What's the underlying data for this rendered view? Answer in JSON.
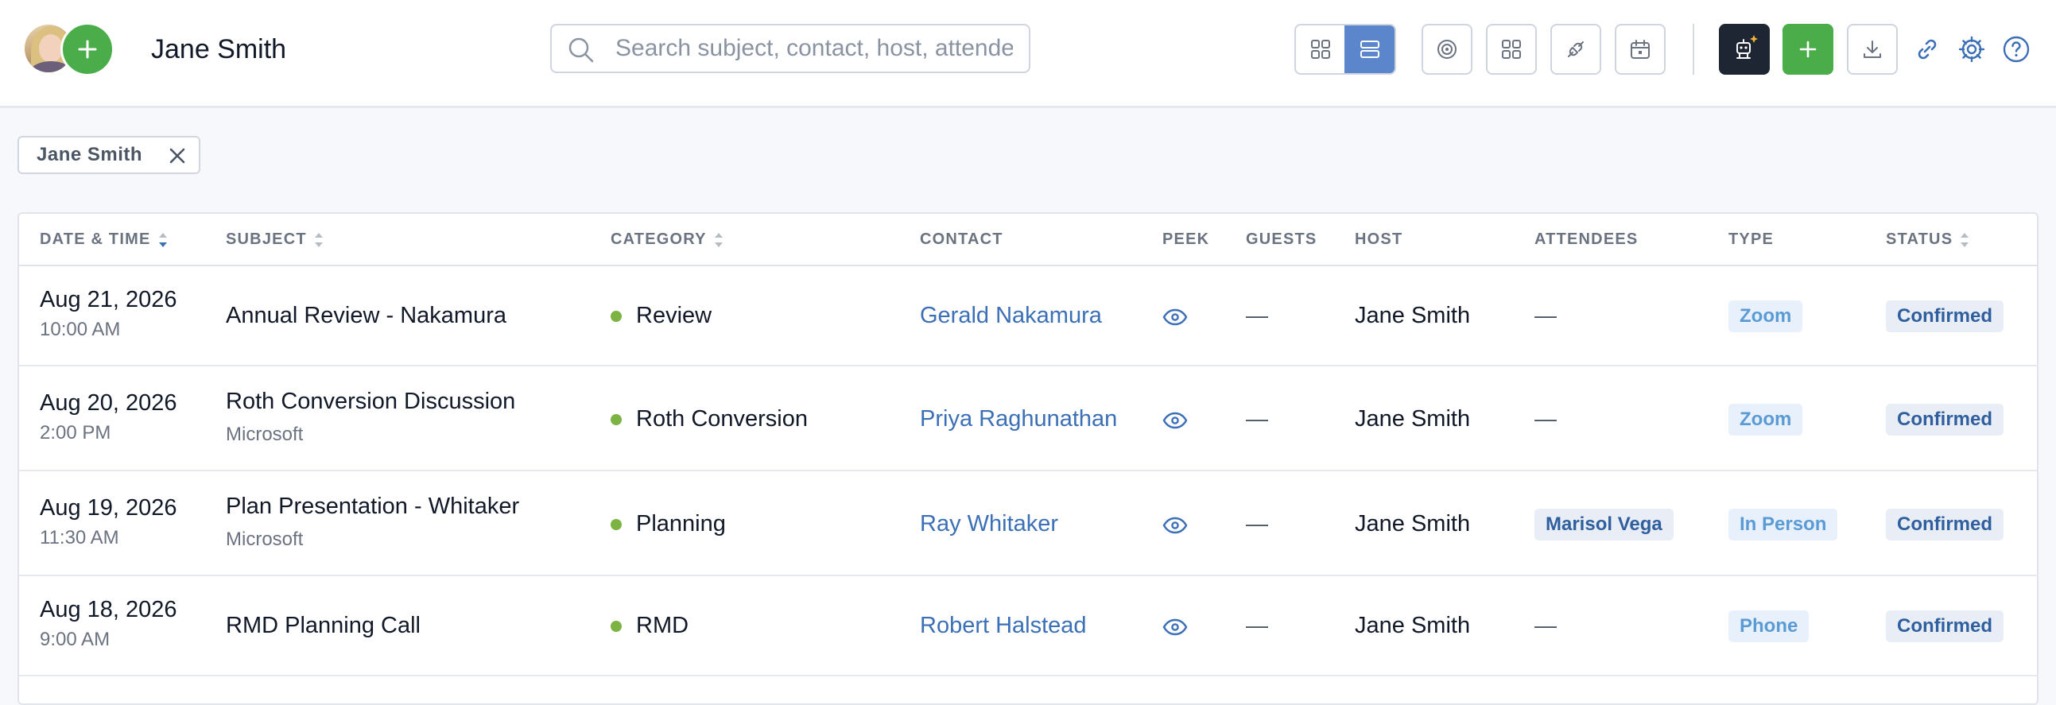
{
  "header": {
    "user_name": "Jane Smith",
    "search_placeholder": "Search subject, contact, host, attendees..."
  },
  "toolbar": {
    "icons": [
      "grid-view-icon",
      "list-view-icon",
      "target-icon",
      "apps-icon",
      "integration-icon",
      "calendar-icon",
      "ai-assistant-icon",
      "add-icon",
      "download-icon",
      "link-icon",
      "settings-icon",
      "help-icon"
    ],
    "accent": "#5b86cc",
    "green": "#4aad4a"
  },
  "filters": [
    {
      "label": "Jane Smith"
    }
  ],
  "table": {
    "columns": [
      "DATE & TIME",
      "SUBJECT",
      "CATEGORY",
      "CONTACT",
      "PEEK",
      "GUESTS",
      "HOST",
      "ATTENDEES",
      "TYPE",
      "STATUS"
    ],
    "rows": [
      {
        "date": "Aug 21, 2026",
        "time": "10:00 AM",
        "subject": "Annual Review - Nakamura",
        "subtitle": "",
        "category": "Review",
        "contact": "Gerald Nakamura",
        "guests": "—",
        "host": "Jane Smith",
        "attendees": "—",
        "type": "Zoom",
        "status": "Confirmed"
      },
      {
        "date": "Aug 20, 2026",
        "time": "2:00 PM",
        "subject": "Roth Conversion Discussion",
        "subtitle": "Microsoft",
        "category": "Roth Conversion",
        "contact": "Priya Raghunathan",
        "guests": "—",
        "host": "Jane Smith",
        "attendees": "—",
        "type": "Zoom",
        "status": "Confirmed"
      },
      {
        "date": "Aug 19, 2026",
        "time": "11:30 AM",
        "subject": "Plan Presentation - Whitaker",
        "subtitle": "Microsoft",
        "category": "Planning",
        "contact": "Ray Whitaker",
        "guests": "—",
        "host": "Jane Smith",
        "attendees": "Marisol Vega",
        "type": "In Person",
        "status": "Confirmed"
      },
      {
        "date": "Aug 18, 2026",
        "time": "9:00 AM",
        "subject": "RMD Planning Call",
        "subtitle": "",
        "category": "RMD",
        "contact": "Robert Halstead",
        "guests": "—",
        "host": "Jane Smith",
        "attendees": "—",
        "type": "Phone",
        "status": "Confirmed"
      }
    ]
  }
}
